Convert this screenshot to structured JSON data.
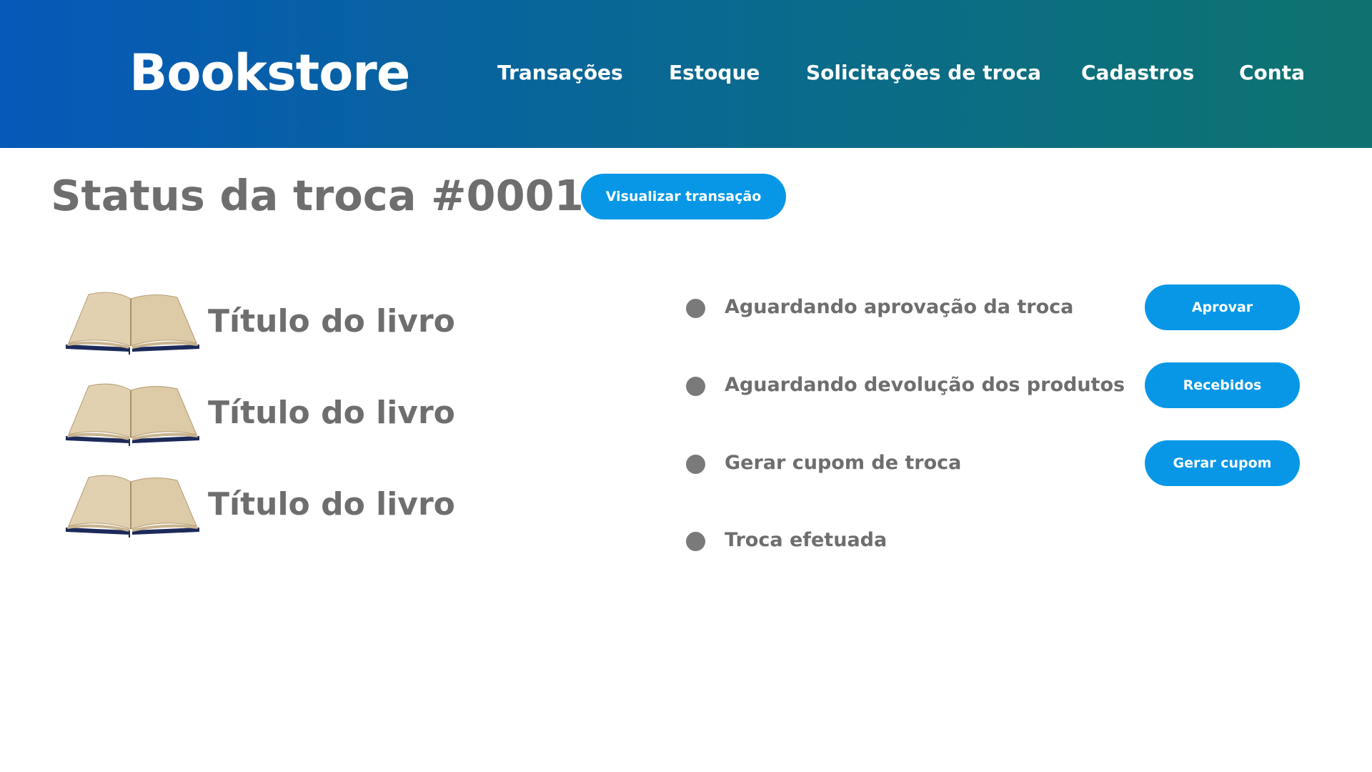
{
  "header": {
    "logo": "Bookstore",
    "nav": [
      {
        "label": "Transações"
      },
      {
        "label": "Estoque"
      },
      {
        "label": "Solicitações de troca"
      },
      {
        "label": "Cadastros"
      },
      {
        "label": "Conta"
      }
    ]
  },
  "main": {
    "title": "Status da troca #0001",
    "view_transaction_label": "Visualizar transação",
    "books": [
      {
        "title": "Título do livro",
        "icon": "open-book-icon"
      },
      {
        "title": "Título do livro",
        "icon": "open-book-icon"
      },
      {
        "title": "Título do livro",
        "icon": "open-book-icon"
      }
    ],
    "steps": [
      {
        "label": "Aguardando aprovação da troca",
        "action": "Aprovar"
      },
      {
        "label": "Aguardando devolução dos produtos",
        "action": "Recebidos"
      },
      {
        "label": "Gerar cupom de troca",
        "action": "Gerar cupom"
      },
      {
        "label": "Troca efetuada"
      }
    ]
  },
  "colors": {
    "header_gradient_start": "#0559b8",
    "header_gradient_end": "#0e736f",
    "button": "#0797e6",
    "text_gray": "#6e6e6e",
    "dot_gray": "#7a7a7a"
  }
}
